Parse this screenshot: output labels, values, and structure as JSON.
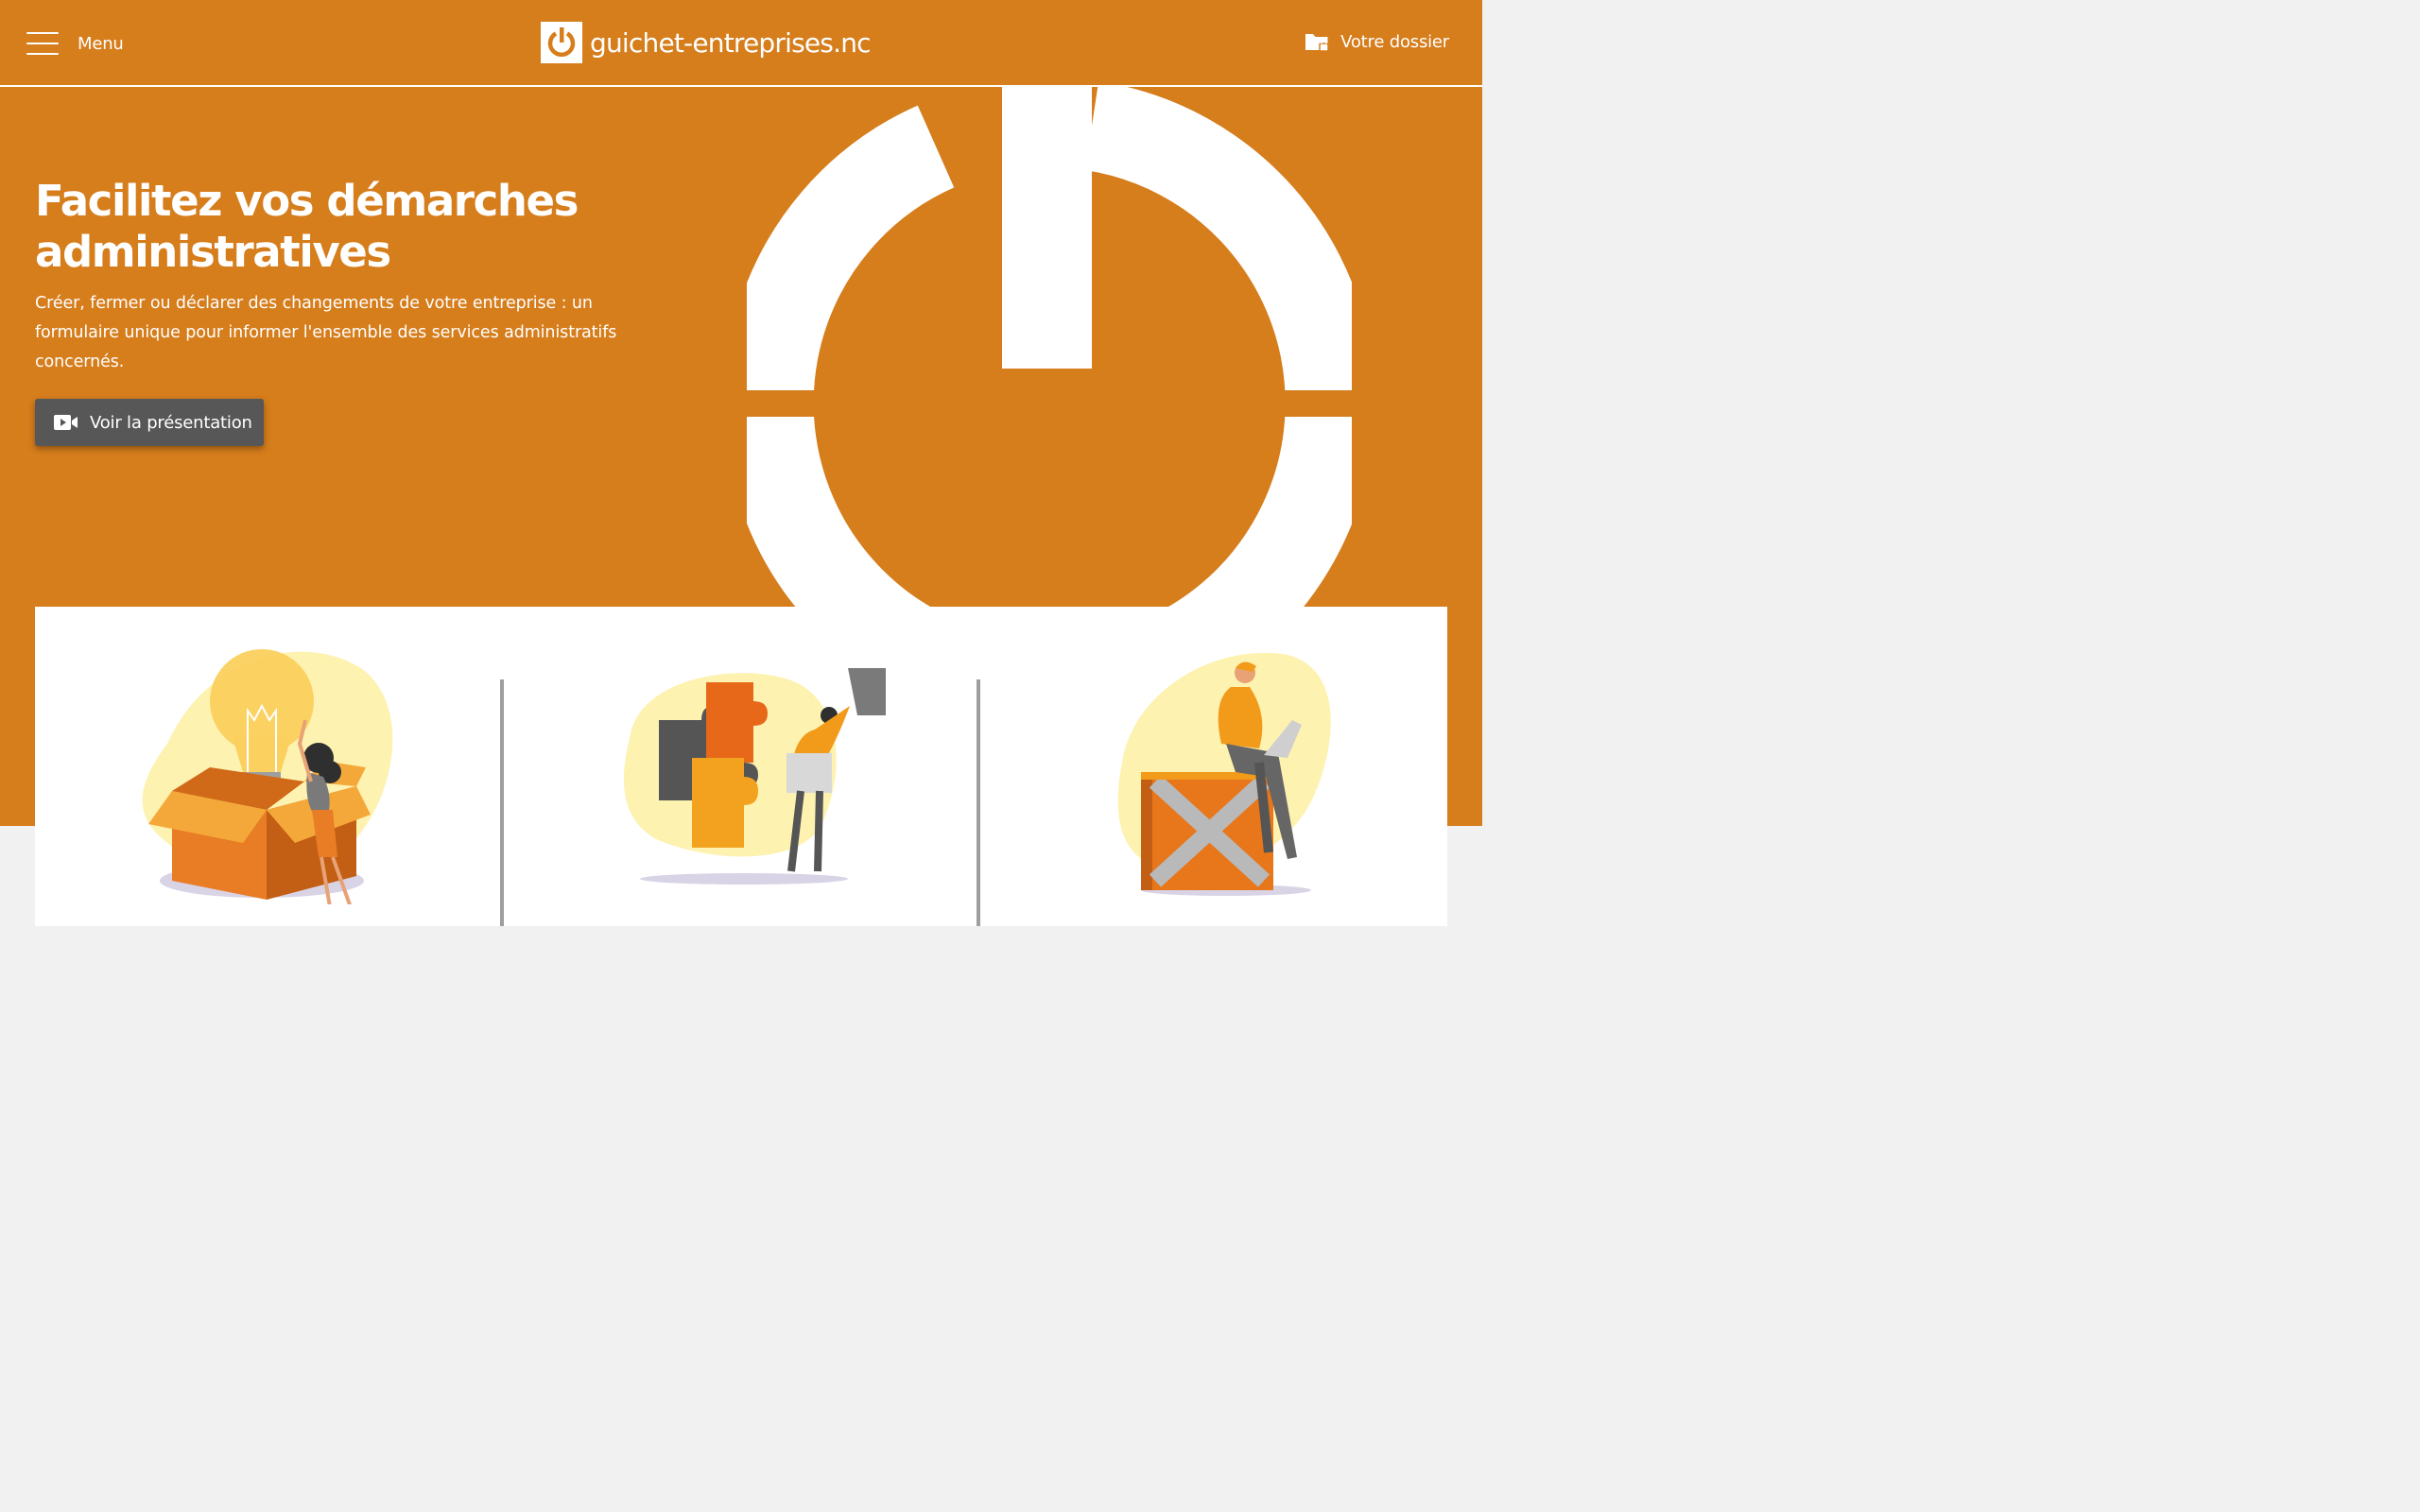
{
  "header": {
    "menu_label": "Menu",
    "logo_text": "guichet-entreprises.nc",
    "dossier_label": "Votre dossier"
  },
  "hero": {
    "title": "Facilitez vos démarches administratives",
    "subtitle": "Créer, fermer ou déclarer des changements de votre entreprise : un formulaire unique pour informer l'ensemble des services administratifs concernés.",
    "button_label": "Voir la présentation"
  },
  "colors": {
    "brand_orange": "#d67d1c",
    "button_gray": "#575757",
    "white": "#ffffff",
    "page_gray": "#f1f1f1"
  },
  "icons": [
    "menu-icon",
    "power-logo-icon",
    "folder-lock-icon",
    "video-camera-icon"
  ],
  "cards": [
    {
      "illustration": "idea-box-illustration"
    },
    {
      "illustration": "puzzle-illustration"
    },
    {
      "illustration": "laptop-crate-illustration"
    }
  ]
}
